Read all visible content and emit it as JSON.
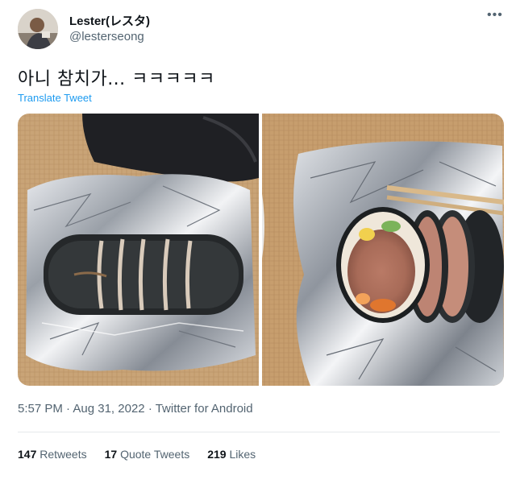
{
  "user": {
    "display_name": "Lester(レスタ)",
    "handle": "@lesterseong"
  },
  "tweet": {
    "text": "아니 참치가... ㅋㅋㅋㅋㅋ",
    "translate_label": "Translate Tweet",
    "time": "5:57 PM",
    "date": "Aug 31, 2022",
    "source": "Twitter for Android",
    "separator": "·"
  },
  "stats": [
    {
      "count": "147",
      "label": "Retweets"
    },
    {
      "count": "17",
      "label": "Quote Tweets"
    },
    {
      "count": "219",
      "label": "Likes"
    }
  ],
  "icons": {
    "more": "more-options-icon"
  },
  "colors": {
    "text_primary": "#0f1419",
    "text_secondary": "#536471",
    "link": "#1d9bf0"
  }
}
